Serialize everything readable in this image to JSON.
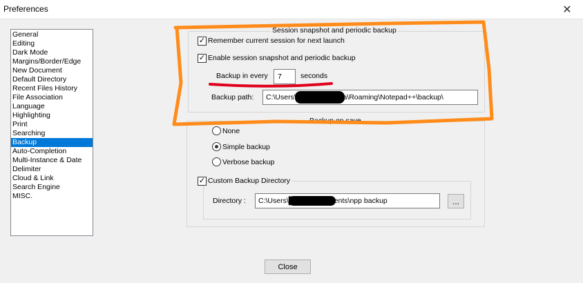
{
  "window": {
    "title": "Preferences",
    "close_glyph": "✕"
  },
  "categories": [
    "General",
    "Editing",
    "Dark Mode",
    "Margins/Border/Edge",
    "New Document",
    "Default Directory",
    "Recent Files History",
    "File Association",
    "Language",
    "Highlighting",
    "Print",
    "Searching",
    "Backup",
    "Auto-Completion",
    "Multi-Instance & Date",
    "Delimiter",
    "Cloud & Link",
    "Search Engine",
    "MISC."
  ],
  "selected_category": "Backup",
  "session": {
    "group_label": "Session snapshot and periodic backup",
    "remember_label": "Remember current session for next launch",
    "remember_checked": true,
    "enable_label": "Enable session snapshot and periodic backup",
    "enable_checked": true,
    "backup_every_label": "Backup in every",
    "backup_every_value": "7",
    "seconds_label": "seconds",
    "path_label": "Backup path:",
    "path_value": "C:\\Users\\████\\AppData\\Roaming\\Notepad++\\backup\\"
  },
  "backup_on_save": {
    "group_label": "Backup on save",
    "options": [
      "None",
      "Simple backup",
      "Verbose backup"
    ],
    "selected": "Simple backup",
    "custom_dir_label": "Custom Backup Directory",
    "custom_dir_checked": true,
    "directory_label": "Directory :",
    "directory_value": "C:\\Users\\████\\Documents\\npp backup",
    "browse_label": "..."
  },
  "close_button_label": "Close",
  "annotation": {
    "color": "#ff8c1a",
    "underline_color": "#e0001b"
  }
}
